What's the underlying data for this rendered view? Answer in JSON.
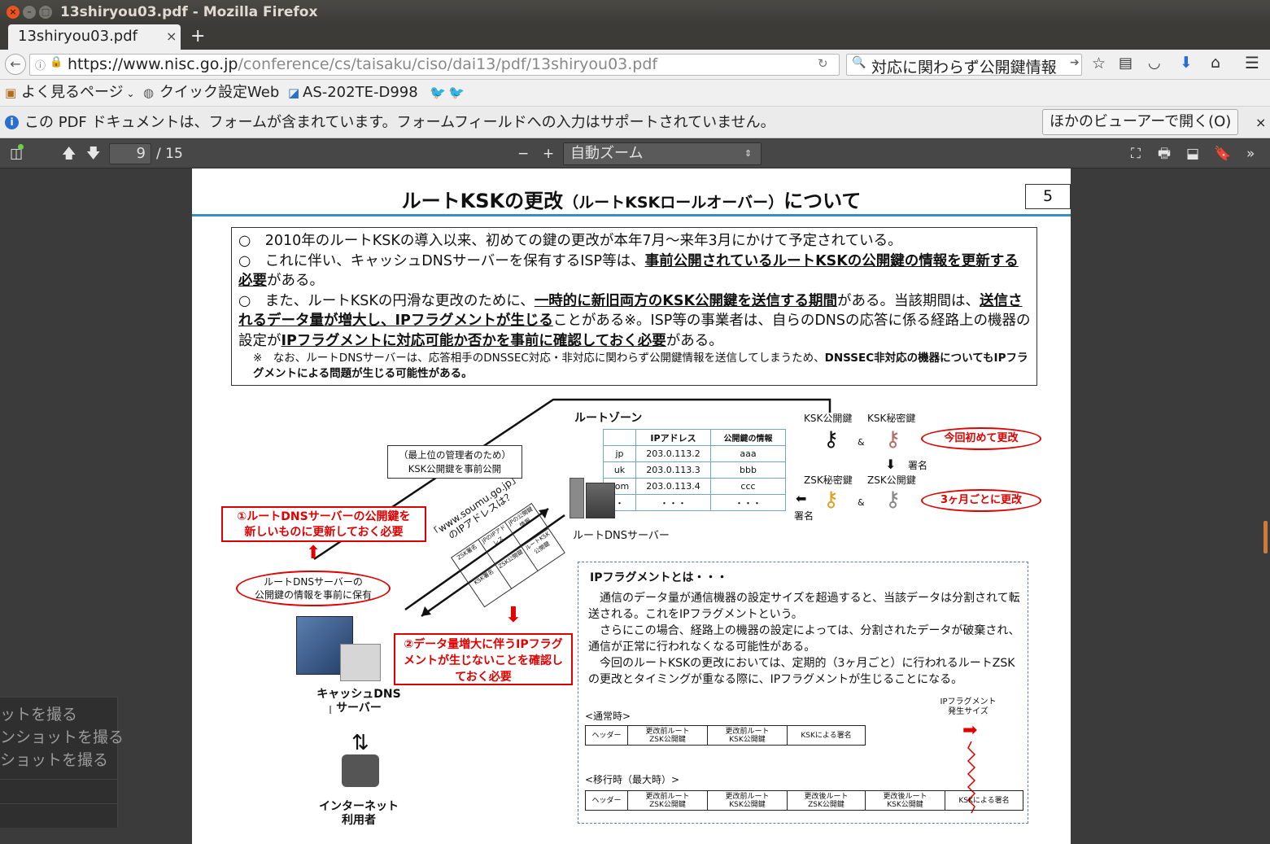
{
  "window": {
    "title": "13shiryou03.pdf - Mozilla Firefox"
  },
  "tab": {
    "label": "13shiryou03.pdf",
    "close": "×",
    "new": "+"
  },
  "nav": {
    "url_host": "https://www.nisc.go.jp",
    "url_path": "/conference/cs/taisaku/ciso/dai13/pdf/13shiryou03.pdf",
    "search_value": "対応に関わらず公開鍵情報"
  },
  "bookmarks": {
    "items": [
      "よく見るページ",
      "クイック設定Web",
      "AS-202TE-D998"
    ]
  },
  "notice": {
    "text": "この PDF ドキュメントは、フォームが含まれています。フォームフィールドへの入力はサポートされていません。",
    "open_button": "ほかのビューアーで開く(O)",
    "close": "×"
  },
  "pdf_toolbar": {
    "page_current": "9",
    "page_total": "/ 15",
    "zoom_minus": "−",
    "zoom_plus": "+",
    "zoom_value": "自動ズーム"
  },
  "doc": {
    "title_main": "ルートKSKの更改",
    "title_sub": "（ルートKSKロールオーバー）",
    "title_end": "について",
    "page_number": "5",
    "bullets": [
      "○　2010年のルートKSKの導入以来、初めての鍵の更改が本年7月～来年3月にかけて予定されている。",
      "○　これに伴い、キャッシュDNSサーバーを保有するISP等は、",
      "事前公開されているルートKSKの公開鍵の情報を更新する必要",
      "がある。",
      "○　また、ルートKSKの円滑な更改のために、",
      "一時的に新旧両方のKSK公開鍵を送信する期間",
      "がある。当該期間は、",
      "送信されるデータ量が増大し、IPフラグメントが生じる",
      "ことがある※。ISP等の事業者は、自らのDNSの応答に係る経路上の機器の設定が",
      "IPフラグメントに対応可能か否かを事前に確認しておく必要",
      "がある。"
    ],
    "note": "※　なお、ルートDNSサーバーは、応答相手のDNSSEC対応・非対応に関わらず公開鍵情報を送信してしまうため、",
    "note_bold": "DNSSEC非対応の機器についてもIPフラグメントによる問題が生じる可能性がある。",
    "diagram": {
      "root_zone": "ルートゾーン",
      "table_headers": [
        "IPアドレス",
        "公開鍵の情報"
      ],
      "table_rows": [
        [
          "jp",
          "203.0.113.2",
          "aaa"
        ],
        [
          "uk",
          "203.0.113.3",
          "bbb"
        ],
        [
          "com",
          "203.0.113.4",
          "ccc"
        ],
        [
          "・",
          "・・・",
          "・・・"
        ]
      ],
      "root_dns_server": "ルートDNSサーバー",
      "pre_publish": "（最上位の管理者のため）\nKSK公開鍵を事前公開",
      "ksk_pub": "KSK公開鍵",
      "ksk_priv": "KSK秘密鍵",
      "zsk_priv": "ZSK秘密鍵",
      "zsk_pub": "ZSK公開鍵",
      "amp": "&",
      "sign": "署名",
      "first_change": "今回初めて更改",
      "quarterly_change": "3ヶ月ごとに更改",
      "callout1": "①ルートDNSサーバーの公開鍵を\n新しいものに更新しておく必要",
      "callout2": "②データ量増大に伴うIPフラグメントが生じないことを確認しておく必要",
      "ellipse": "ルートDNSサーバーの\n公開鍵の情報を事前に保有",
      "query": "「www.soumu.go.jp」\nのIPアドレスは？",
      "cache_dns": "キャッシュDNS\nサーバー",
      "internet_user": "インターネット\n利用者",
      "packet_labels": [
        "ZSK署名",
        "JPのIPアドレス",
        "JPの公開鍵情報",
        "KSK署名",
        "ZSK公開鍵",
        "ルートKSK公開鍵"
      ]
    },
    "ipfrag": {
      "heading": "IPフラグメントとは・・・",
      "p1": "通信のデータ量が通信機器の設定サイズを超過すると、当該データは分割されて転送される。これをIPフラグメントという。",
      "p2": "さらにこの場合、経路上の機器の設定によっては、分割されたデータが破棄され、通信が正常に行われなくなる可能性がある。",
      "p3": "今回のルートKSKの更改においては、定期的（3ヶ月ごと）に行われるルートZSKの更改とタイミングが重なる際に、IPフラグメントが生じることになる。",
      "normal_label": "<通常時>",
      "transition_label": "<移行時（最大時）>",
      "frag_size": "IPフラグメント\n発生サイズ",
      "normal_cells": [
        "ヘッダー",
        "更改前ルート\nZSK公開鍵",
        "更改前ルート\nKSK公開鍵",
        "KSKによる署名"
      ],
      "transition_cells": [
        "ヘッダー",
        "更改前ルート\nZSK公開鍵",
        "更改前ルート\nKSK公開鍵",
        "更改後ルート\nZSK公開鍵",
        "更改後ルート\nKSK公開鍵",
        "KSKによる署名"
      ]
    }
  },
  "context_menu": {
    "items": [
      "ットを撮る",
      "ンショットを撮る",
      "ショットを撮る"
    ]
  },
  "colors": {
    "accent_red": "#e00000",
    "titlebar": "#3c3b37",
    "toolbar": "#474747"
  }
}
